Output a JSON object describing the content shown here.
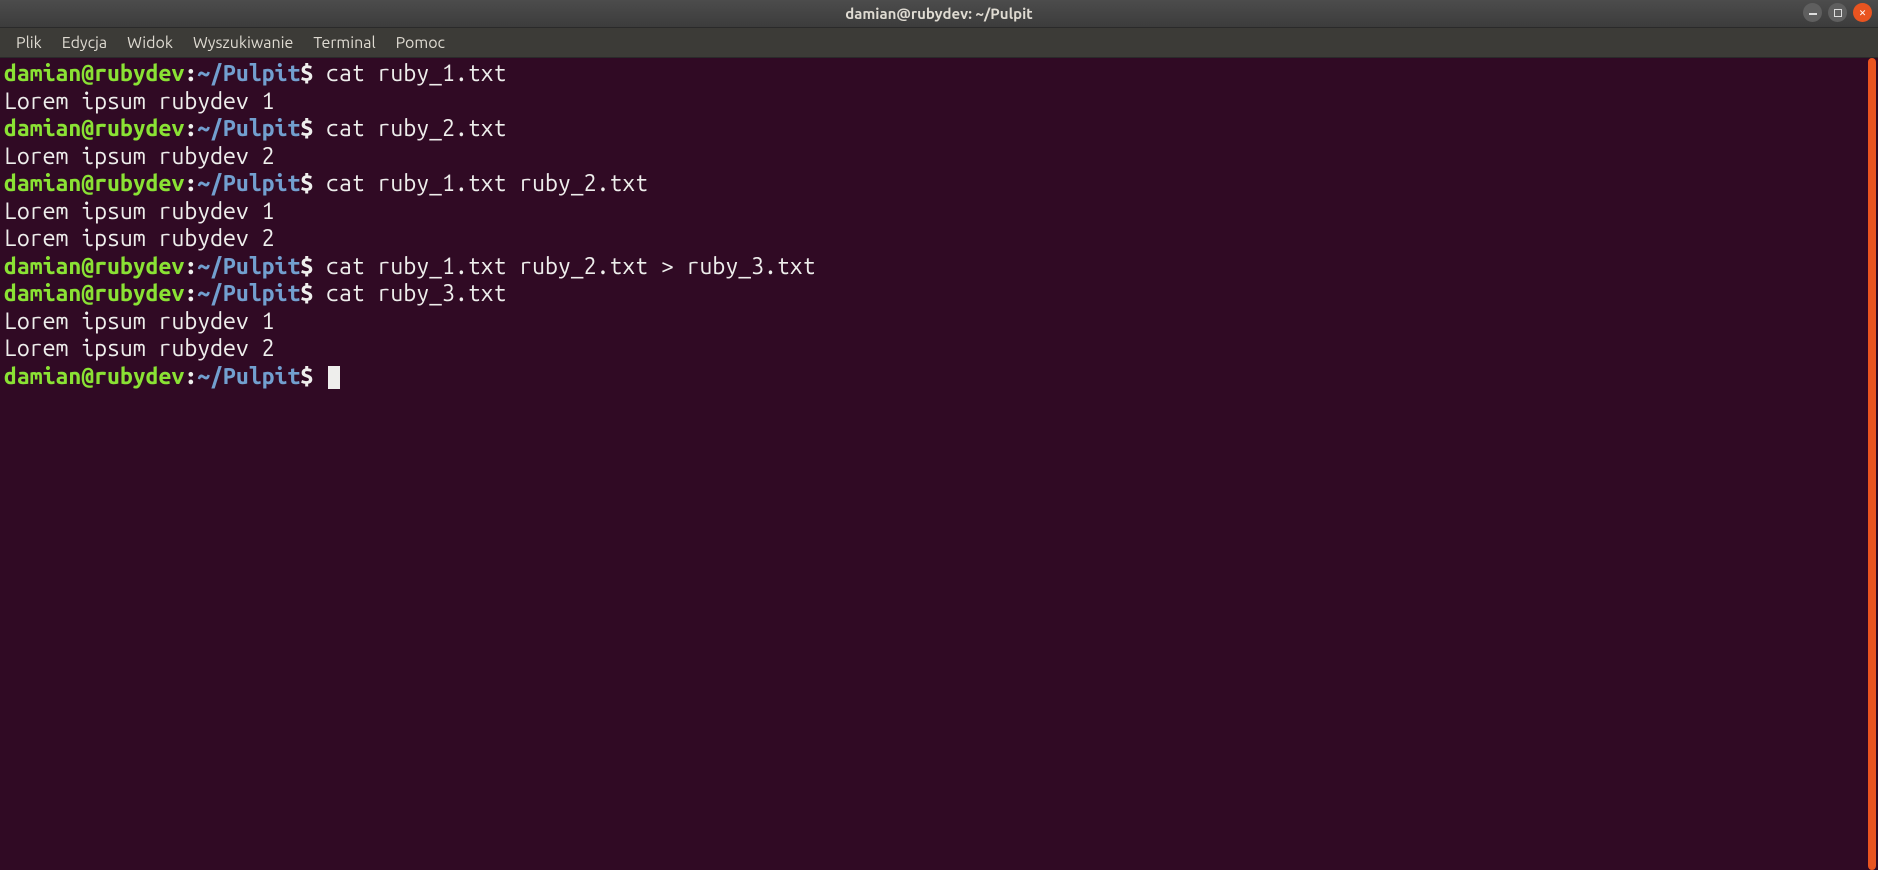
{
  "window": {
    "title": "damian@rubydev: ~/Pulpit"
  },
  "menubar": {
    "items": [
      "Plik",
      "Edycja",
      "Widok",
      "Wyszukiwanie",
      "Terminal",
      "Pomoc"
    ]
  },
  "prompt": {
    "user_host": "damian@rubydev",
    "colon": ":",
    "path": "~/Pulpit",
    "symbol": "$"
  },
  "lines": [
    {
      "type": "cmd",
      "command": "cat ruby_1.txt"
    },
    {
      "type": "out",
      "text": "Lorem ipsum rubydev 1"
    },
    {
      "type": "cmd",
      "command": "cat ruby_2.txt"
    },
    {
      "type": "out",
      "text": "Lorem ipsum rubydev 2"
    },
    {
      "type": "cmd",
      "command": "cat ruby_1.txt ruby_2.txt"
    },
    {
      "type": "out",
      "text": "Lorem ipsum rubydev 1"
    },
    {
      "type": "out",
      "text": "Lorem ipsum rubydev 2"
    },
    {
      "type": "cmd",
      "command": "cat ruby_1.txt ruby_2.txt > ruby_3.txt"
    },
    {
      "type": "cmd",
      "command": "cat ruby_3.txt"
    },
    {
      "type": "out",
      "text": "Lorem ipsum rubydev 1"
    },
    {
      "type": "out",
      "text": "Lorem ipsum rubydev 2"
    },
    {
      "type": "prompt"
    }
  ],
  "colors": {
    "background": "#300a24",
    "prompt_user": "#8ae234",
    "prompt_path": "#729fcf",
    "text": "#eeeeec",
    "accent": "#e95420"
  }
}
